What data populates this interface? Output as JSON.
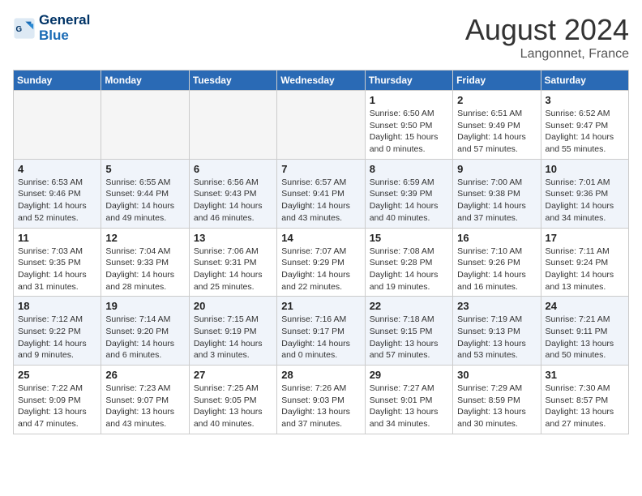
{
  "header": {
    "logo_line1": "General",
    "logo_line2": "Blue",
    "month_title": "August 2024",
    "location": "Langonnet, France"
  },
  "weekdays": [
    "Sunday",
    "Monday",
    "Tuesday",
    "Wednesday",
    "Thursday",
    "Friday",
    "Saturday"
  ],
  "weeks": [
    {
      "alt": false,
      "days": [
        {
          "num": "",
          "empty": true
        },
        {
          "num": "",
          "empty": true
        },
        {
          "num": "",
          "empty": true
        },
        {
          "num": "",
          "empty": true
        },
        {
          "num": "1",
          "sunrise": "6:50 AM",
          "sunset": "9:50 PM",
          "daylight": "15 hours and 0 minutes."
        },
        {
          "num": "2",
          "sunrise": "6:51 AM",
          "sunset": "9:49 PM",
          "daylight": "14 hours and 57 minutes."
        },
        {
          "num": "3",
          "sunrise": "6:52 AM",
          "sunset": "9:47 PM",
          "daylight": "14 hours and 55 minutes."
        }
      ]
    },
    {
      "alt": true,
      "days": [
        {
          "num": "4",
          "sunrise": "6:53 AM",
          "sunset": "9:46 PM",
          "daylight": "14 hours and 52 minutes."
        },
        {
          "num": "5",
          "sunrise": "6:55 AM",
          "sunset": "9:44 PM",
          "daylight": "14 hours and 49 minutes."
        },
        {
          "num": "6",
          "sunrise": "6:56 AM",
          "sunset": "9:43 PM",
          "daylight": "14 hours and 46 minutes."
        },
        {
          "num": "7",
          "sunrise": "6:57 AM",
          "sunset": "9:41 PM",
          "daylight": "14 hours and 43 minutes."
        },
        {
          "num": "8",
          "sunrise": "6:59 AM",
          "sunset": "9:39 PM",
          "daylight": "14 hours and 40 minutes."
        },
        {
          "num": "9",
          "sunrise": "7:00 AM",
          "sunset": "9:38 PM",
          "daylight": "14 hours and 37 minutes."
        },
        {
          "num": "10",
          "sunrise": "7:01 AM",
          "sunset": "9:36 PM",
          "daylight": "14 hours and 34 minutes."
        }
      ]
    },
    {
      "alt": false,
      "days": [
        {
          "num": "11",
          "sunrise": "7:03 AM",
          "sunset": "9:35 PM",
          "daylight": "14 hours and 31 minutes."
        },
        {
          "num": "12",
          "sunrise": "7:04 AM",
          "sunset": "9:33 PM",
          "daylight": "14 hours and 28 minutes."
        },
        {
          "num": "13",
          "sunrise": "7:06 AM",
          "sunset": "9:31 PM",
          "daylight": "14 hours and 25 minutes."
        },
        {
          "num": "14",
          "sunrise": "7:07 AM",
          "sunset": "9:29 PM",
          "daylight": "14 hours and 22 minutes."
        },
        {
          "num": "15",
          "sunrise": "7:08 AM",
          "sunset": "9:28 PM",
          "daylight": "14 hours and 19 minutes."
        },
        {
          "num": "16",
          "sunrise": "7:10 AM",
          "sunset": "9:26 PM",
          "daylight": "14 hours and 16 minutes."
        },
        {
          "num": "17",
          "sunrise": "7:11 AM",
          "sunset": "9:24 PM",
          "daylight": "14 hours and 13 minutes."
        }
      ]
    },
    {
      "alt": true,
      "days": [
        {
          "num": "18",
          "sunrise": "7:12 AM",
          "sunset": "9:22 PM",
          "daylight": "14 hours and 9 minutes."
        },
        {
          "num": "19",
          "sunrise": "7:14 AM",
          "sunset": "9:20 PM",
          "daylight": "14 hours and 6 minutes."
        },
        {
          "num": "20",
          "sunrise": "7:15 AM",
          "sunset": "9:19 PM",
          "daylight": "14 hours and 3 minutes."
        },
        {
          "num": "21",
          "sunrise": "7:16 AM",
          "sunset": "9:17 PM",
          "daylight": "14 hours and 0 minutes."
        },
        {
          "num": "22",
          "sunrise": "7:18 AM",
          "sunset": "9:15 PM",
          "daylight": "13 hours and 57 minutes."
        },
        {
          "num": "23",
          "sunrise": "7:19 AM",
          "sunset": "9:13 PM",
          "daylight": "13 hours and 53 minutes."
        },
        {
          "num": "24",
          "sunrise": "7:21 AM",
          "sunset": "9:11 PM",
          "daylight": "13 hours and 50 minutes."
        }
      ]
    },
    {
      "alt": false,
      "days": [
        {
          "num": "25",
          "sunrise": "7:22 AM",
          "sunset": "9:09 PM",
          "daylight": "13 hours and 47 minutes."
        },
        {
          "num": "26",
          "sunrise": "7:23 AM",
          "sunset": "9:07 PM",
          "daylight": "13 hours and 43 minutes."
        },
        {
          "num": "27",
          "sunrise": "7:25 AM",
          "sunset": "9:05 PM",
          "daylight": "13 hours and 40 minutes."
        },
        {
          "num": "28",
          "sunrise": "7:26 AM",
          "sunset": "9:03 PM",
          "daylight": "13 hours and 37 minutes."
        },
        {
          "num": "29",
          "sunrise": "7:27 AM",
          "sunset": "9:01 PM",
          "daylight": "13 hours and 34 minutes."
        },
        {
          "num": "30",
          "sunrise": "7:29 AM",
          "sunset": "8:59 PM",
          "daylight": "13 hours and 30 minutes."
        },
        {
          "num": "31",
          "sunrise": "7:30 AM",
          "sunset": "8:57 PM",
          "daylight": "13 hours and 27 minutes."
        }
      ]
    }
  ]
}
